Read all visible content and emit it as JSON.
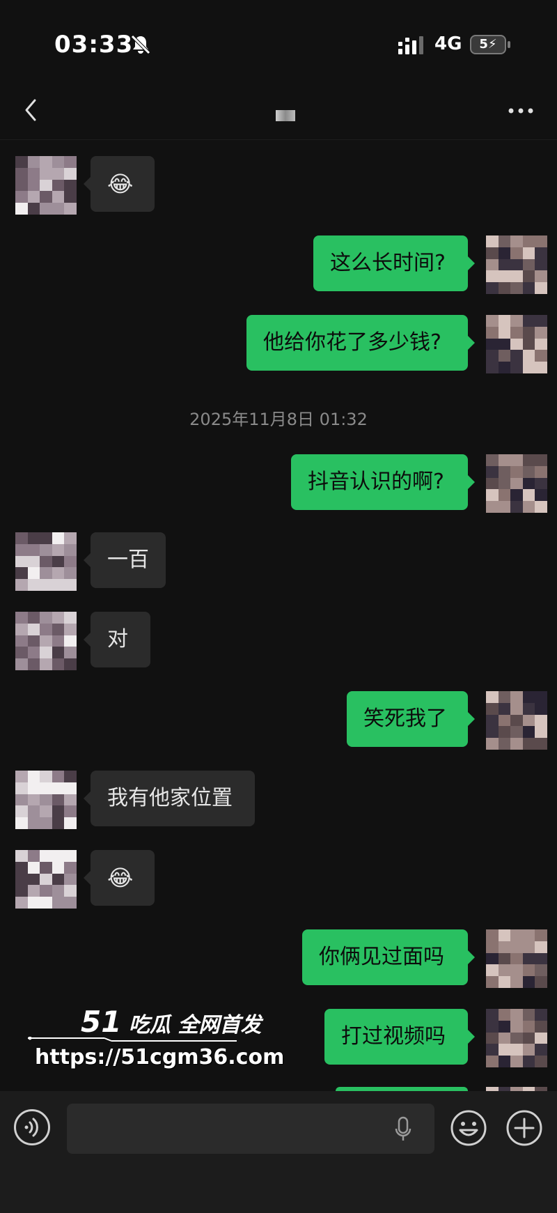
{
  "status": {
    "time": "03:33",
    "network": "4G",
    "battery": "5"
  },
  "nav": {
    "title": ""
  },
  "timestamp": "2025年11月8日 01:32",
  "messages": [
    {
      "side": "in",
      "text": "😂"
    },
    {
      "side": "out",
      "text": "这么长时间?"
    },
    {
      "side": "out",
      "text": "他给你花了多少钱?"
    },
    {
      "side": "out",
      "text": "抖音认识的啊?"
    },
    {
      "side": "in",
      "text": "一百"
    },
    {
      "side": "in",
      "text": "对"
    },
    {
      "side": "out",
      "text": "笑死我了"
    },
    {
      "side": "in",
      "text": "我有他家位置"
    },
    {
      "side": "in",
      "text": "😂"
    },
    {
      "side": "out",
      "text": "你俩见过面吗"
    },
    {
      "side": "out",
      "text": "打过视频吗"
    }
  ],
  "watermark": {
    "logo": "51",
    "tagline": "吃瓜 全网首发",
    "url": "https://51cgm36.com"
  },
  "input": {
    "placeholder": ""
  }
}
